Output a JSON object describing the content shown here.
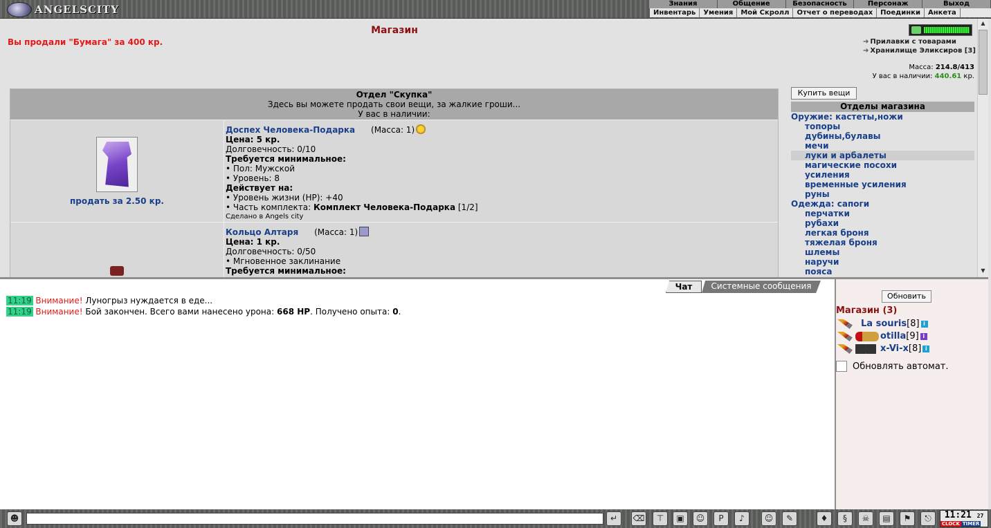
{
  "app": {
    "logo_text": "ANGELSCITY"
  },
  "top_menu": [
    "Знания",
    "Общение",
    "Безопасность",
    "Персонаж",
    "Выход"
  ],
  "sub_menu": [
    "Инвентарь",
    "Умения",
    "Мой Скролл",
    "Отчет о переводах",
    "Поединки",
    "Анкета"
  ],
  "shop": {
    "title": "Магазин",
    "sold_message": "Вы продали \"Бумага\" за 400 кр.",
    "links": [
      "Прилавки с товарами",
      "Хранилище Эликсиров [3]"
    ],
    "mass_label": "Масса:",
    "mass_value": "214.8/413",
    "money_label": "У вас в наличии:",
    "money_value": "440.61",
    "money_unit": "кр.",
    "hp_level": 0.95
  },
  "department": {
    "name": "Отдел \"Скупка\"",
    "description": "Здесь вы можете продать свои вещи, за жалкие гроши...",
    "in_stock": "У вас в наличии:",
    "items": [
      {
        "name": "Доспех Человека-Подарка",
        "mass": "(Масса: 1)",
        "price": "Цена: 5 кр.",
        "durability": "Долговечность: 0/10",
        "req_title": "Требуется минимальное:",
        "req_gender": "• Пол: Мужской",
        "req_level": "• Уровень: 8",
        "effect_title": "Действует на:",
        "effect_hp": "• Уровень жизни (HP): +40",
        "set_prefix": "• Часть комплекта:",
        "set_name": "Комплект Человека-Подарка",
        "set_count": "[1/2]",
        "made_in": "Сделано в Angels city",
        "sell": "продать за 2.50 кр."
      },
      {
        "name": "Кольцо Алтаря",
        "mass": "(Масса: 1)",
        "price": "Цена: 1 кр.",
        "durability": "Долговечность: 0/50",
        "spell": "• Мгновенное заклинание",
        "req_title": "Требуется минимальное:"
      }
    ]
  },
  "buy_button": "Купить вещи",
  "categories_title": "Отделы магазина",
  "categories": [
    {
      "label": "Оружие: кастеты,ножи",
      "sub": false,
      "selected": false
    },
    {
      "label": "топоры",
      "sub": true,
      "selected": false
    },
    {
      "label": "дубины,булавы",
      "sub": true,
      "selected": false
    },
    {
      "label": "мечи",
      "sub": true,
      "selected": false
    },
    {
      "label": "луки и арбалеты",
      "sub": true,
      "selected": true
    },
    {
      "label": "магические посохи",
      "sub": true,
      "selected": false
    },
    {
      "label": "усиления",
      "sub": true,
      "selected": false
    },
    {
      "label": "временные усиления",
      "sub": true,
      "selected": false
    },
    {
      "label": "руны",
      "sub": true,
      "selected": false
    },
    {
      "label": "Одежда: сапоги",
      "sub": false,
      "selected": false
    },
    {
      "label": "перчатки",
      "sub": true,
      "selected": false
    },
    {
      "label": "рубахи",
      "sub": true,
      "selected": false
    },
    {
      "label": "легкая броня",
      "sub": true,
      "selected": false
    },
    {
      "label": "тяжелая броня",
      "sub": true,
      "selected": false
    },
    {
      "label": "шлемы",
      "sub": true,
      "selected": false
    },
    {
      "label": "наручи",
      "sub": true,
      "selected": false
    },
    {
      "label": "пояса",
      "sub": true,
      "selected": false
    }
  ],
  "chat": {
    "tab_chat": "Чат",
    "tab_system": "Системные сообщения",
    "messages": [
      {
        "time": "11:19",
        "tag": "Внимание!",
        "text": "Луногрыз нуждается в еде..."
      },
      {
        "time": "11:19",
        "tag": "Внимание!",
        "text_pre": "Бой закончен. Всего вами нанесено урона:",
        "damage": "668 HP",
        "text_mid": ". Получено опыта:",
        "exp": "0",
        "text_end": "."
      }
    ]
  },
  "room": {
    "refresh": "Обновить",
    "title": "Магазин (3)",
    "users": [
      {
        "name": "La souris",
        "level": "[8]"
      },
      {
        "name": "otilla",
        "level": "[9]"
      },
      {
        "name": "x-Vi-x",
        "level": "[8]"
      }
    ],
    "auto_refresh": "Обновлять автомат."
  },
  "clock": {
    "time": "11:21",
    "seconds": "27",
    "label_clock": "CLOCK",
    "label_timer": "TIMER"
  }
}
